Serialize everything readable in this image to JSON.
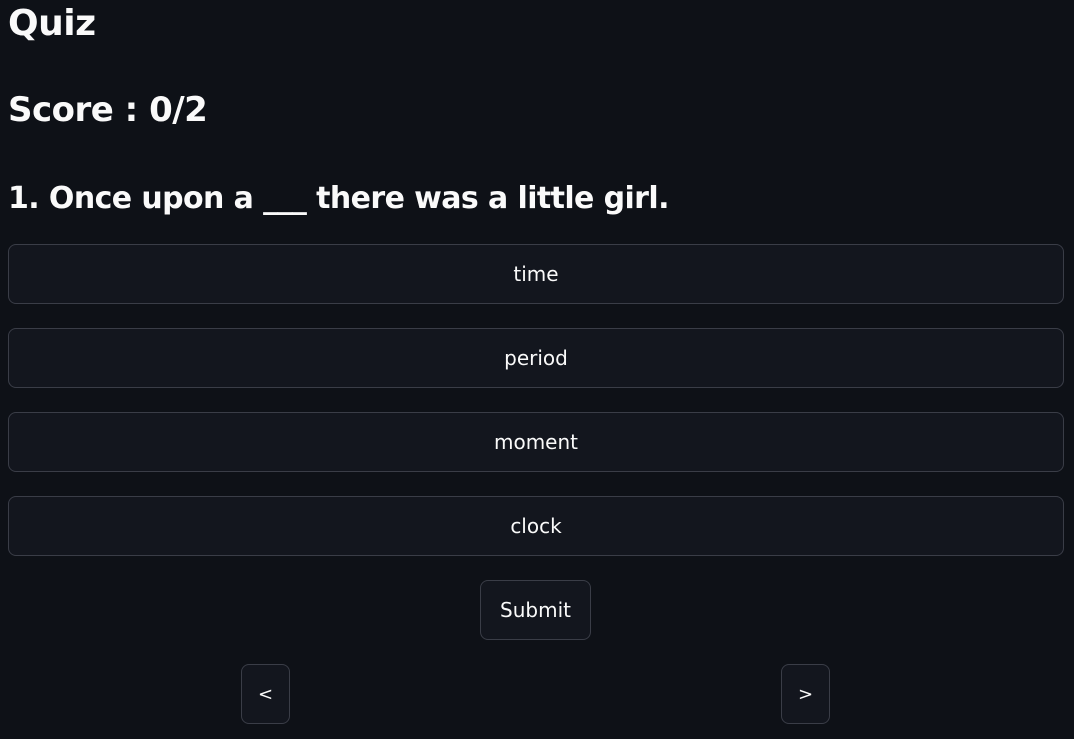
{
  "app": {
    "title": "Quiz"
  },
  "score": {
    "text": "Score : 0/2"
  },
  "question": {
    "text": "1. Once upon a ___ there was a little girl."
  },
  "options": [
    {
      "label": "time"
    },
    {
      "label": "period"
    },
    {
      "label": "moment"
    },
    {
      "label": "clock"
    }
  ],
  "actions": {
    "submit_label": "Submit",
    "prev_label": "<",
    "next_label": ">"
  },
  "colors": {
    "background": "#0e1117",
    "button_bg": "#13161e",
    "button_border": "#3a3d47",
    "text": "#fafafa"
  }
}
